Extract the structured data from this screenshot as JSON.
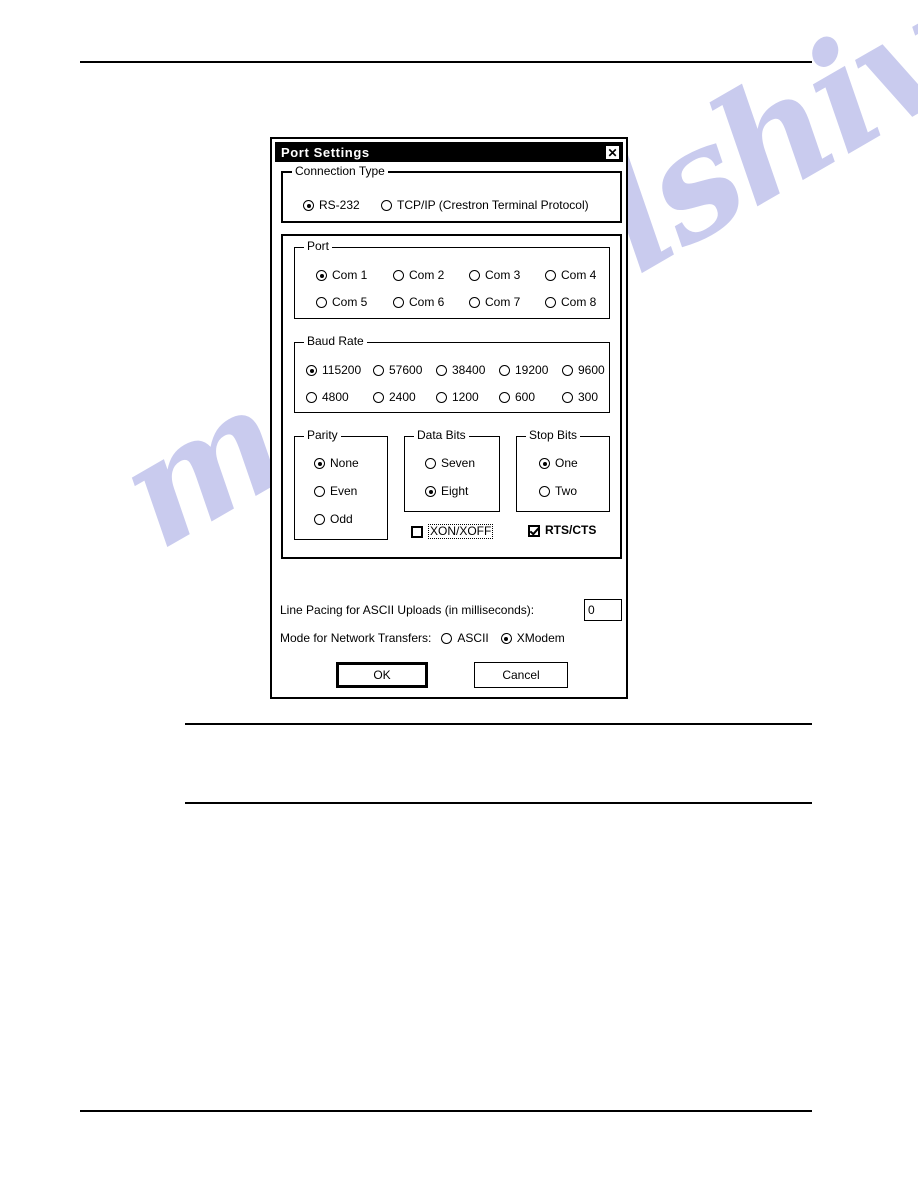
{
  "page": {
    "watermark_text": "manualshive.com"
  },
  "dialog": {
    "title": "Port Settings",
    "close_icon": "close-x-icon",
    "connection_type": {
      "legend": "Connection Type",
      "options": [
        {
          "label": "RS-232",
          "selected": true
        },
        {
          "label": "TCP/IP (Crestron Terminal Protocol)",
          "selected": false
        }
      ]
    },
    "port": {
      "legend": "Port",
      "options": [
        {
          "label": "Com 1",
          "selected": true
        },
        {
          "label": "Com 2",
          "selected": false
        },
        {
          "label": "Com 3",
          "selected": false
        },
        {
          "label": "Com 4",
          "selected": false
        },
        {
          "label": "Com 5",
          "selected": false
        },
        {
          "label": "Com 6",
          "selected": false
        },
        {
          "label": "Com 7",
          "selected": false
        },
        {
          "label": "Com 8",
          "selected": false
        }
      ]
    },
    "baud_rate": {
      "legend": "Baud Rate",
      "options": [
        {
          "label": "115200",
          "selected": true
        },
        {
          "label": "57600",
          "selected": false
        },
        {
          "label": "38400",
          "selected": false
        },
        {
          "label": "19200",
          "selected": false
        },
        {
          "label": "9600",
          "selected": false
        },
        {
          "label": "4800",
          "selected": false
        },
        {
          "label": "2400",
          "selected": false
        },
        {
          "label": "1200",
          "selected": false
        },
        {
          "label": "600",
          "selected": false
        },
        {
          "label": "300",
          "selected": false
        }
      ]
    },
    "parity": {
      "legend": "Parity",
      "options": [
        {
          "label": "None",
          "selected": true
        },
        {
          "label": "Even",
          "selected": false
        },
        {
          "label": "Odd",
          "selected": false
        }
      ]
    },
    "data_bits": {
      "legend": "Data Bits",
      "options": [
        {
          "label": "Seven",
          "selected": false
        },
        {
          "label": "Eight",
          "selected": true
        }
      ]
    },
    "stop_bits": {
      "legend": "Stop Bits",
      "options": [
        {
          "label": "One",
          "selected": true
        },
        {
          "label": "Two",
          "selected": false
        }
      ]
    },
    "flow_control": {
      "xon_xoff": {
        "label": "XON/XOFF",
        "checked": false,
        "focused": true
      },
      "rts_cts": {
        "label": "RTS/CTS",
        "checked": true,
        "focused": false
      }
    },
    "line_pacing": {
      "label": "Line Pacing for ASCII Uploads (in milliseconds):",
      "value": "0"
    },
    "network_transfers": {
      "label": "Mode for Network Transfers:",
      "options": [
        {
          "label": "ASCII",
          "selected": false
        },
        {
          "label": "XModem",
          "selected": true
        }
      ]
    },
    "buttons": {
      "ok": "OK",
      "cancel": "Cancel"
    }
  }
}
